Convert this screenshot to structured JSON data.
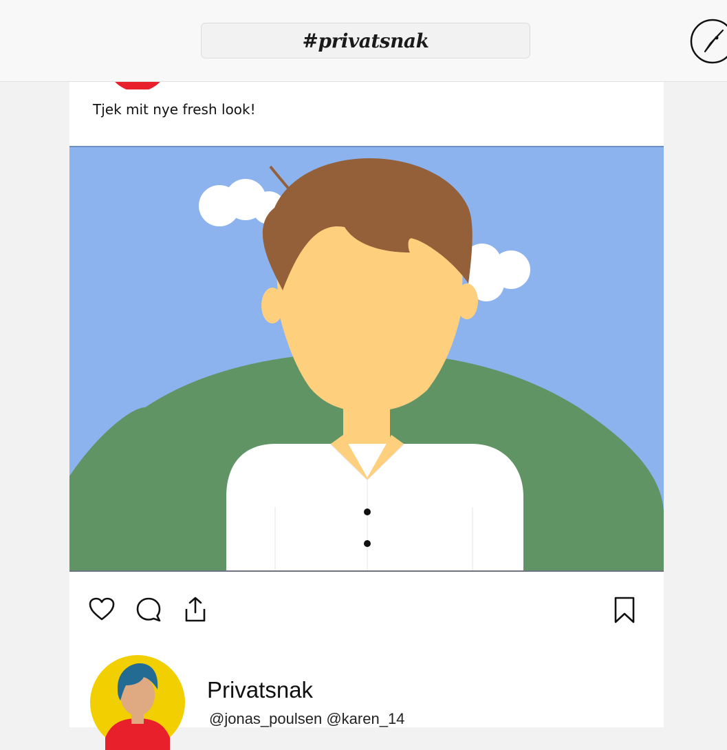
{
  "search": {
    "query": "#privatsnak"
  },
  "post": {
    "caption": "Tjek mit nye fresh look!"
  },
  "actions": {
    "icons": [
      "heart-icon",
      "comment-icon",
      "share-icon",
      "bookmark-icon"
    ]
  },
  "profile": {
    "name": "Privatsnak",
    "tags": "@jonas_poulsen @karen_14"
  },
  "colors": {
    "sky": "#8cb3ee",
    "hill": "#609465",
    "hair": "#93603a",
    "skin": "#fecf7c",
    "shirt": "#ffffff",
    "avatar_bg": "#f2cf00",
    "avatar_accent": "#e8202b"
  }
}
